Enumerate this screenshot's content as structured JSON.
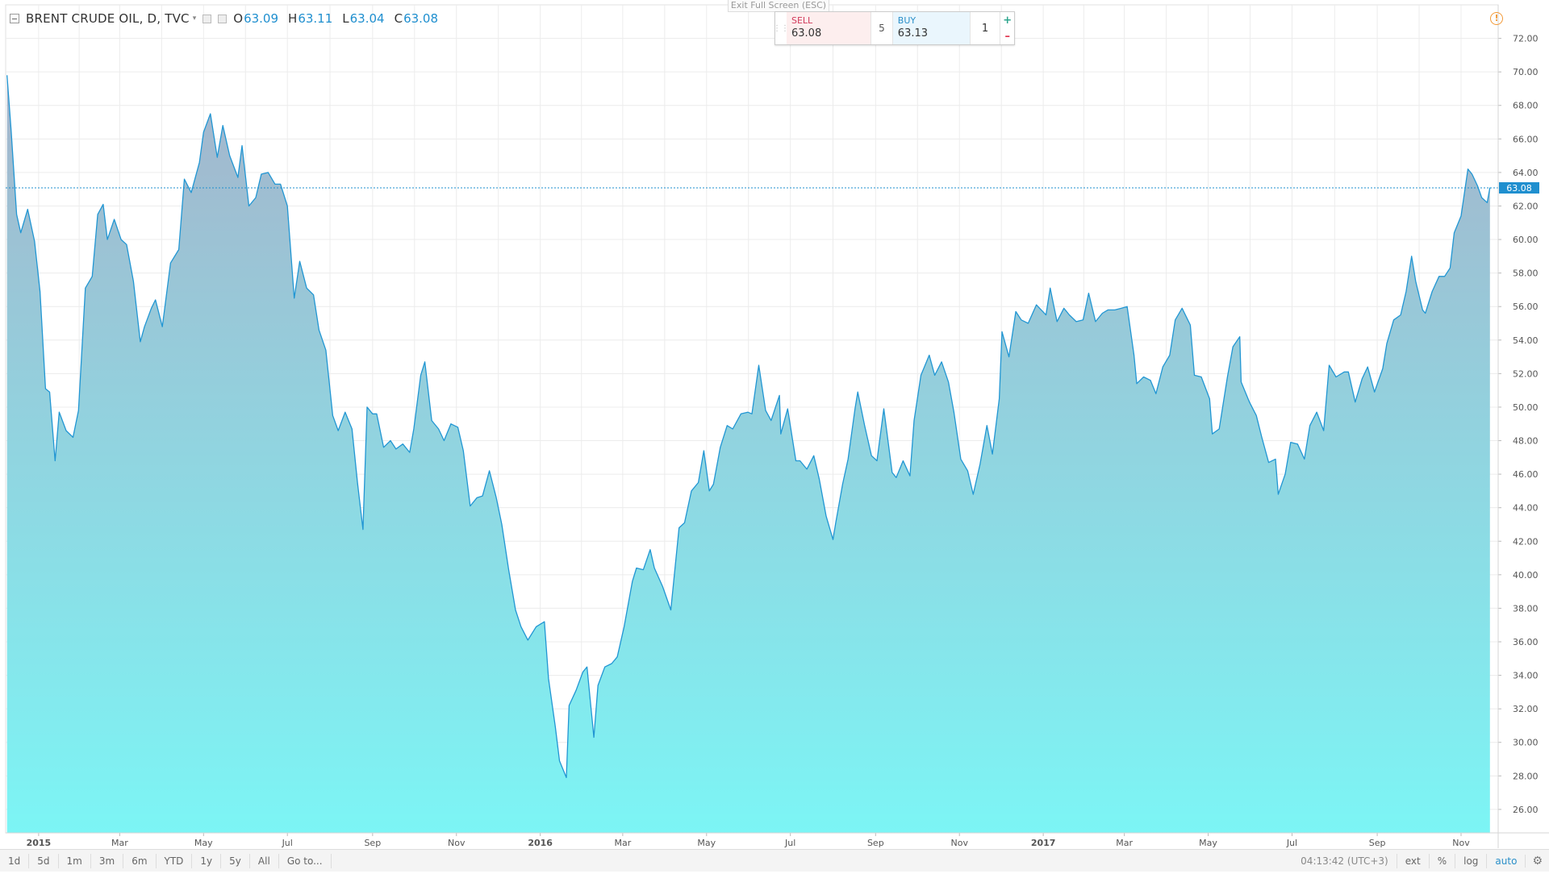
{
  "header": {
    "symbol": "BRENT CRUDE OIL, D, TVC",
    "ohlc": {
      "o_label": "O",
      "o_value": "63.09",
      "h_label": "H",
      "h_value": "63.11",
      "l_label": "L",
      "l_value": "63.04",
      "c_label": "C",
      "c_value": "63.08"
    }
  },
  "exit_fullscreen": "Exit Full Screen (ESC)",
  "trade_panel": {
    "sell_label": "SELL",
    "sell_price": "63.08",
    "spread": "5",
    "buy_label": "BUY",
    "buy_price": "63.13",
    "quantity": "1",
    "plus": "+",
    "minus": "–"
  },
  "icons": {
    "alert": "alert-warning-icon",
    "settings": "gear-icon"
  },
  "colors": {
    "line": "#2196d3",
    "area_top": "#a5b4cb",
    "area_bottom": "#7cf5f5",
    "price_tag": "#1f8fcf",
    "axis_text": "#555555",
    "grid": "#ececec"
  },
  "bottom_bar": {
    "ranges": [
      "1d",
      "5d",
      "1m",
      "3m",
      "6m",
      "YTD",
      "1y",
      "5y",
      "All",
      "Go to..."
    ],
    "time": "04:13:42 (UTC+3)",
    "options": [
      "ext",
      "%",
      "log",
      "auto"
    ],
    "active_option": "auto"
  },
  "chart_data": {
    "type": "area",
    "title": "BRENT CRUDE OIL, D, TVC",
    "x_ticks": [
      "2015",
      "Mar",
      "May",
      "Jul",
      "Sep",
      "Nov",
      "2016",
      "Mar",
      "May",
      "Jul",
      "Sep",
      "Nov",
      "2017",
      "Mar",
      "May",
      "Jul",
      "Sep",
      "Nov"
    ],
    "x_tick_bold": [
      true,
      false,
      false,
      false,
      false,
      false,
      true,
      false,
      false,
      false,
      false,
      false,
      true,
      false,
      false,
      false,
      false,
      false
    ],
    "xlim": [
      "2014-12-08",
      "2017-11-28"
    ],
    "ylim": [
      24.6,
      74.0
    ],
    "y_ticks": [
      "26.00",
      "28.00",
      "30.00",
      "32.00",
      "34.00",
      "36.00",
      "38.00",
      "40.00",
      "42.00",
      "44.00",
      "46.00",
      "48.00",
      "50.00",
      "52.00",
      "54.00",
      "56.00",
      "58.00",
      "60.00",
      "62.00",
      "64.00",
      "66.00",
      "68.00",
      "70.00",
      "72.00"
    ],
    "y_tick_values": [
      26,
      28,
      30,
      32,
      34,
      36,
      38,
      40,
      42,
      44,
      46,
      48,
      50,
      52,
      54,
      56,
      58,
      60,
      62,
      64,
      66,
      68,
      70,
      72
    ],
    "last_price": 63.08,
    "last_price_label": "63.08",
    "grid": true,
    "series": [
      {
        "points": [
          [
            "2014-12-09",
            69.8
          ],
          [
            "2014-12-12",
            66.5
          ],
          [
            "2014-12-16",
            61.5
          ],
          [
            "2014-12-19",
            60.4
          ],
          [
            "2014-12-24",
            61.8
          ],
          [
            "2014-12-29",
            59.9
          ],
          [
            "2015-01-02",
            56.9
          ],
          [
            "2015-01-06",
            51.1
          ],
          [
            "2015-01-09",
            50.9
          ],
          [
            "2015-01-13",
            46.8
          ],
          [
            "2015-01-16",
            49.7
          ],
          [
            "2015-01-21",
            48.6
          ],
          [
            "2015-01-26",
            48.2
          ],
          [
            "2015-01-30",
            49.8
          ],
          [
            "2015-02-04",
            57.1
          ],
          [
            "2015-02-09",
            57.8
          ],
          [
            "2015-02-13",
            61.5
          ],
          [
            "2015-02-17",
            62.1
          ],
          [
            "2015-02-20",
            60.0
          ],
          [
            "2015-02-25",
            61.2
          ],
          [
            "2015-03-02",
            60.0
          ],
          [
            "2015-03-06",
            59.7
          ],
          [
            "2015-03-11",
            57.5
          ],
          [
            "2015-03-16",
            53.9
          ],
          [
            "2015-03-19",
            54.8
          ],
          [
            "2015-03-24",
            55.9
          ],
          [
            "2015-03-27",
            56.4
          ],
          [
            "2015-04-01",
            54.8
          ],
          [
            "2015-04-07",
            58.6
          ],
          [
            "2015-04-13",
            59.4
          ],
          [
            "2015-04-17",
            63.6
          ],
          [
            "2015-04-22",
            62.8
          ],
          [
            "2015-04-28",
            64.6
          ],
          [
            "2015-05-01",
            66.4
          ],
          [
            "2015-05-06",
            67.5
          ],
          [
            "2015-05-11",
            64.9
          ],
          [
            "2015-05-15",
            66.8
          ],
          [
            "2015-05-20",
            65.0
          ],
          [
            "2015-05-26",
            63.7
          ],
          [
            "2015-05-29",
            65.6
          ],
          [
            "2015-06-03",
            62.0
          ],
          [
            "2015-06-08",
            62.5
          ],
          [
            "2015-06-12",
            63.9
          ],
          [
            "2015-06-17",
            64.0
          ],
          [
            "2015-06-22",
            63.3
          ],
          [
            "2015-06-26",
            63.3
          ],
          [
            "2015-07-01",
            62.0
          ],
          [
            "2015-07-06",
            56.5
          ],
          [
            "2015-07-10",
            58.7
          ],
          [
            "2015-07-15",
            57.1
          ],
          [
            "2015-07-20",
            56.7
          ],
          [
            "2015-07-24",
            54.6
          ],
          [
            "2015-07-29",
            53.4
          ],
          [
            "2015-08-03",
            49.5
          ],
          [
            "2015-08-07",
            48.6
          ],
          [
            "2015-08-12",
            49.7
          ],
          [
            "2015-08-17",
            48.7
          ],
          [
            "2015-08-21",
            45.5
          ],
          [
            "2015-08-25",
            42.7
          ],
          [
            "2015-08-28",
            50.0
          ],
          [
            "2015-09-01",
            49.6
          ],
          [
            "2015-09-04",
            49.6
          ],
          [
            "2015-09-09",
            47.6
          ],
          [
            "2015-09-14",
            48.0
          ],
          [
            "2015-09-18",
            47.5
          ],
          [
            "2015-09-23",
            47.8
          ],
          [
            "2015-09-28",
            47.3
          ],
          [
            "2015-10-01",
            48.7
          ],
          [
            "2015-10-06",
            51.9
          ],
          [
            "2015-10-09",
            52.7
          ],
          [
            "2015-10-14",
            49.2
          ],
          [
            "2015-10-19",
            48.7
          ],
          [
            "2015-10-23",
            48.0
          ],
          [
            "2015-10-28",
            49.0
          ],
          [
            "2015-11-02",
            48.8
          ],
          [
            "2015-11-06",
            47.4
          ],
          [
            "2015-11-11",
            44.1
          ],
          [
            "2015-11-16",
            44.6
          ],
          [
            "2015-11-20",
            44.7
          ],
          [
            "2015-11-25",
            46.2
          ],
          [
            "2015-11-30",
            44.6
          ],
          [
            "2015-12-04",
            43.0
          ],
          [
            "2015-12-09",
            40.3
          ],
          [
            "2015-12-14",
            37.9
          ],
          [
            "2015-12-18",
            36.9
          ],
          [
            "2015-12-23",
            36.1
          ],
          [
            "2015-12-29",
            36.9
          ],
          [
            "2016-01-04",
            37.2
          ],
          [
            "2016-01-07",
            33.8
          ],
          [
            "2016-01-12",
            30.9
          ],
          [
            "2016-01-15",
            28.9
          ],
          [
            "2016-01-20",
            27.9
          ],
          [
            "2016-01-22",
            32.2
          ],
          [
            "2016-01-27",
            33.1
          ],
          [
            "2016-02-01",
            34.2
          ],
          [
            "2016-02-04",
            34.5
          ],
          [
            "2016-02-09",
            30.3
          ],
          [
            "2016-02-12",
            33.4
          ],
          [
            "2016-02-17",
            34.5
          ],
          [
            "2016-02-22",
            34.7
          ],
          [
            "2016-02-26",
            35.1
          ],
          [
            "2016-03-02",
            36.9
          ],
          [
            "2016-03-08",
            39.6
          ],
          [
            "2016-03-11",
            40.4
          ],
          [
            "2016-03-16",
            40.3
          ],
          [
            "2016-03-21",
            41.5
          ],
          [
            "2016-03-24",
            40.4
          ],
          [
            "2016-03-30",
            39.3
          ],
          [
            "2016-04-05",
            37.9
          ],
          [
            "2016-04-11",
            42.8
          ],
          [
            "2016-04-15",
            43.1
          ],
          [
            "2016-04-20",
            45.0
          ],
          [
            "2016-04-25",
            45.5
          ],
          [
            "2016-04-29",
            47.4
          ],
          [
            "2016-05-03",
            45.0
          ],
          [
            "2016-05-06",
            45.4
          ],
          [
            "2016-05-11",
            47.6
          ],
          [
            "2016-05-16",
            48.9
          ],
          [
            "2016-05-20",
            48.7
          ],
          [
            "2016-05-26",
            49.6
          ],
          [
            "2016-05-31",
            49.7
          ],
          [
            "2016-06-03",
            49.6
          ],
          [
            "2016-06-08",
            52.5
          ],
          [
            "2016-06-13",
            49.8
          ],
          [
            "2016-06-17",
            49.2
          ],
          [
            "2016-06-23",
            50.7
          ],
          [
            "2016-06-24",
            48.4
          ],
          [
            "2016-06-29",
            49.9
          ],
          [
            "2016-07-05",
            46.8
          ],
          [
            "2016-07-08",
            46.8
          ],
          [
            "2016-07-13",
            46.3
          ],
          [
            "2016-07-18",
            47.1
          ],
          [
            "2016-07-22",
            45.7
          ],
          [
            "2016-07-27",
            43.5
          ],
          [
            "2016-08-01",
            42.1
          ],
          [
            "2016-08-03",
            43.1
          ],
          [
            "2016-08-08",
            45.4
          ],
          [
            "2016-08-12",
            46.9
          ],
          [
            "2016-08-17",
            49.9
          ],
          [
            "2016-08-19",
            50.9
          ],
          [
            "2016-08-24",
            48.9
          ],
          [
            "2016-08-29",
            47.1
          ],
          [
            "2016-09-02",
            46.8
          ],
          [
            "2016-09-07",
            49.9
          ],
          [
            "2016-09-13",
            46.1
          ],
          [
            "2016-09-16",
            45.8
          ],
          [
            "2016-09-21",
            46.8
          ],
          [
            "2016-09-26",
            45.9
          ],
          [
            "2016-09-29",
            49.2
          ],
          [
            "2016-10-04",
            51.9
          ],
          [
            "2016-10-10",
            53.1
          ],
          [
            "2016-10-14",
            51.9
          ],
          [
            "2016-10-19",
            52.7
          ],
          [
            "2016-10-24",
            51.5
          ],
          [
            "2016-10-28",
            49.7
          ],
          [
            "2016-11-02",
            46.9
          ],
          [
            "2016-11-07",
            46.2
          ],
          [
            "2016-11-11",
            44.8
          ],
          [
            "2016-11-16",
            46.6
          ],
          [
            "2016-11-21",
            48.9
          ],
          [
            "2016-11-25",
            47.2
          ],
          [
            "2016-11-30",
            50.5
          ],
          [
            "2016-12-02",
            54.5
          ],
          [
            "2016-12-07",
            53.0
          ],
          [
            "2016-12-12",
            55.7
          ],
          [
            "2016-12-16",
            55.2
          ],
          [
            "2016-12-21",
            55.0
          ],
          [
            "2016-12-27",
            56.1
          ],
          [
            "2017-01-03",
            55.5
          ],
          [
            "2017-01-06",
            57.1
          ],
          [
            "2017-01-11",
            55.1
          ],
          [
            "2017-01-16",
            55.9
          ],
          [
            "2017-01-20",
            55.5
          ],
          [
            "2017-01-25",
            55.1
          ],
          [
            "2017-01-30",
            55.2
          ],
          [
            "2017-02-03",
            56.8
          ],
          [
            "2017-02-08",
            55.1
          ],
          [
            "2017-02-13",
            55.6
          ],
          [
            "2017-02-17",
            55.8
          ],
          [
            "2017-02-22",
            55.8
          ],
          [
            "2017-02-27",
            55.9
          ],
          [
            "2017-03-03",
            56.0
          ],
          [
            "2017-03-08",
            53.1
          ],
          [
            "2017-03-10",
            51.4
          ],
          [
            "2017-03-15",
            51.8
          ],
          [
            "2017-03-20",
            51.6
          ],
          [
            "2017-03-24",
            50.8
          ],
          [
            "2017-03-29",
            52.4
          ],
          [
            "2017-04-03",
            53.1
          ],
          [
            "2017-04-07",
            55.2
          ],
          [
            "2017-04-12",
            55.9
          ],
          [
            "2017-04-18",
            54.9
          ],
          [
            "2017-04-21",
            51.9
          ],
          [
            "2017-04-26",
            51.8
          ],
          [
            "2017-05-02",
            50.5
          ],
          [
            "2017-05-04",
            48.4
          ],
          [
            "2017-05-09",
            48.7
          ],
          [
            "2017-05-15",
            51.8
          ],
          [
            "2017-05-19",
            53.6
          ],
          [
            "2017-05-24",
            54.2
          ],
          [
            "2017-05-25",
            51.5
          ],
          [
            "2017-05-31",
            50.3
          ],
          [
            "2017-06-05",
            49.5
          ],
          [
            "2017-06-09",
            48.2
          ],
          [
            "2017-06-14",
            46.7
          ],
          [
            "2017-06-19",
            46.9
          ],
          [
            "2017-06-21",
            44.8
          ],
          [
            "2017-06-26",
            46.0
          ],
          [
            "2017-06-30",
            47.9
          ],
          [
            "2017-07-05",
            47.8
          ],
          [
            "2017-07-10",
            46.9
          ],
          [
            "2017-07-14",
            48.9
          ],
          [
            "2017-07-19",
            49.7
          ],
          [
            "2017-07-24",
            48.6
          ],
          [
            "2017-07-28",
            52.5
          ],
          [
            "2017-08-02",
            51.8
          ],
          [
            "2017-08-08",
            52.1
          ],
          [
            "2017-08-11",
            52.1
          ],
          [
            "2017-08-16",
            50.3
          ],
          [
            "2017-08-21",
            51.7
          ],
          [
            "2017-08-25",
            52.4
          ],
          [
            "2017-08-30",
            50.9
          ],
          [
            "2017-09-05",
            52.3
          ],
          [
            "2017-09-08",
            53.8
          ],
          [
            "2017-09-13",
            55.2
          ],
          [
            "2017-09-18",
            55.5
          ],
          [
            "2017-09-22",
            56.9
          ],
          [
            "2017-09-26",
            59.0
          ],
          [
            "2017-09-29",
            57.5
          ],
          [
            "2017-10-04",
            55.8
          ],
          [
            "2017-10-06",
            55.6
          ],
          [
            "2017-10-11",
            56.9
          ],
          [
            "2017-10-16",
            57.8
          ],
          [
            "2017-10-20",
            57.8
          ],
          [
            "2017-10-24",
            58.3
          ],
          [
            "2017-10-27",
            60.4
          ],
          [
            "2017-11-01",
            61.4
          ],
          [
            "2017-11-06",
            64.2
          ],
          [
            "2017-11-09",
            63.9
          ],
          [
            "2017-11-13",
            63.2
          ],
          [
            "2017-11-16",
            62.5
          ],
          [
            "2017-11-20",
            62.2
          ],
          [
            "2017-11-22",
            63.1
          ]
        ]
      }
    ]
  }
}
